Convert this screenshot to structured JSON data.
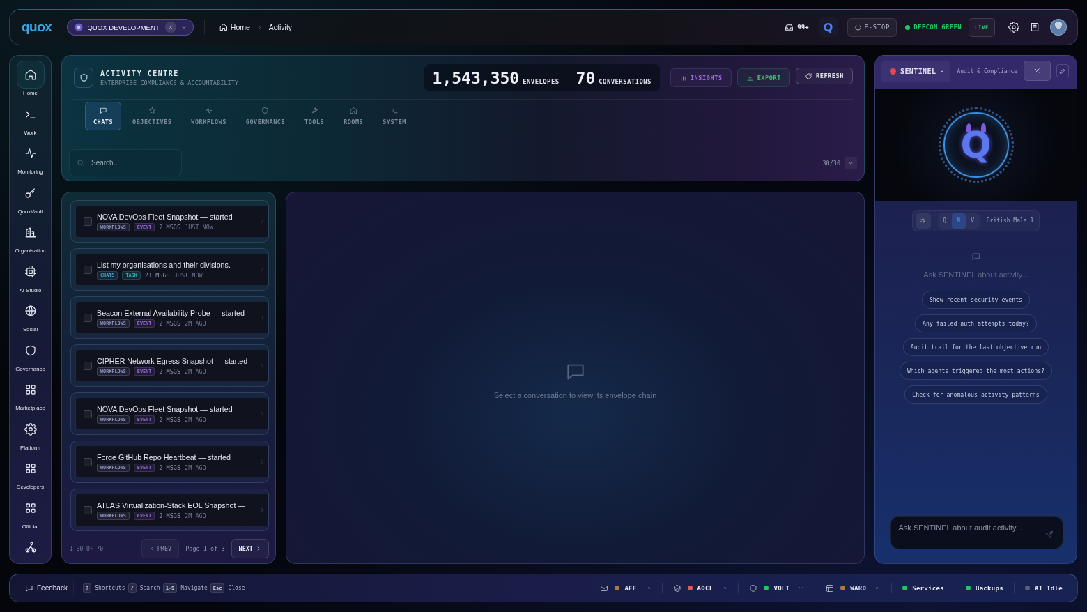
{
  "top_bar": {
    "logo": "quox",
    "workspace": {
      "label": "QUOX DEVELOPMENT"
    },
    "breadcrumb": [
      {
        "label": "Home"
      },
      {
        "label": "Activity"
      }
    ],
    "inbox_count": "99+",
    "assistant": "Q",
    "estop": "E-STOP",
    "defcon": {
      "label": "DEFCON GREEN",
      "color": "#22c55e"
    },
    "live": "LIVE"
  },
  "sidebar": {
    "items": [
      {
        "label": "Home",
        "selected": true
      },
      {
        "label": "Work",
        "selected": false
      },
      {
        "label": "Monitoring",
        "selected": false
      },
      {
        "label": "QuoxVault",
        "selected": false
      },
      {
        "label": "Organisation",
        "selected": false
      },
      {
        "label": "AI Studio",
        "selected": false
      },
      {
        "label": "Social",
        "selected": false
      },
      {
        "label": "Governance",
        "selected": false
      },
      {
        "label": "Marketplace",
        "selected": false
      },
      {
        "label": "Platform",
        "selected": false
      },
      {
        "label": "Developers",
        "selected": false
      },
      {
        "label": "Official",
        "selected": false
      },
      {
        "selected": false
      }
    ]
  },
  "activity": {
    "title": "ACTIVITY CENTRE",
    "subtitle": "ENTERPRISE COMPLIANCE & ACCOUNTABILITY",
    "stats": [
      {
        "value": "1,543,350",
        "label": "ENVELOPES"
      },
      {
        "value": "70",
        "label": "CONVERSATIONS"
      }
    ],
    "actions": [
      {
        "kind": "insights",
        "label": "INSIGHTS"
      },
      {
        "kind": "export",
        "label": "EXPORT"
      },
      {
        "kind": "refresh",
        "label": "REFRESH"
      }
    ],
    "tabs": [
      {
        "label": "CHATS",
        "selected": true
      },
      {
        "label": "OBJECTIVES",
        "selected": false
      },
      {
        "label": "WORKFLOWS",
        "selected": false
      },
      {
        "label": "GOVERNANCE",
        "selected": false
      },
      {
        "label": "TOOLS",
        "selected": false
      },
      {
        "label": "ROOMS",
        "selected": false
      },
      {
        "label": "SYSTEM",
        "selected": false
      }
    ],
    "search": {
      "placeholder": "Search..."
    },
    "count": "30/30"
  },
  "conversations": {
    "items": [
      {
        "title": "NOVA DevOps Fleet Snapshot — started",
        "checked": false,
        "tags": [
          {
            "label": "WORKFLOWS",
            "color": "#9096c8"
          },
          {
            "label": "EVENT",
            "color": "#9a6ae0"
          }
        ],
        "messages": "2 MSGS",
        "time": "JUST NOW"
      },
      {
        "title": "List my organisations and their divisions.",
        "checked": false,
        "tags": [
          {
            "label": "CHATS",
            "color": "#3fa9d6"
          },
          {
            "label": "TASK",
            "color": "#2fb3b8"
          }
        ],
        "messages": "21 MSGS",
        "time": "JUST NOW"
      },
      {
        "title": "Beacon External Availability Probe — started",
        "checked": false,
        "tags": [
          {
            "label": "WORKFLOWS",
            "color": "#9096c8"
          },
          {
            "label": "EVENT",
            "color": "#9a6ae0"
          }
        ],
        "messages": "2 MSGS",
        "time": "2M AGO"
      },
      {
        "title": "CIPHER Network Egress Snapshot — started",
        "checked": false,
        "tags": [
          {
            "label": "WORKFLOWS",
            "color": "#9096c8"
          },
          {
            "label": "EVENT",
            "color": "#9a6ae0"
          }
        ],
        "messages": "2 MSGS",
        "time": "2M AGO"
      },
      {
        "title": "NOVA DevOps Fleet Snapshot — started",
        "checked": false,
        "tags": [
          {
            "label": "WORKFLOWS",
            "color": "#9096c8"
          },
          {
            "label": "EVENT",
            "color": "#9a6ae0"
          }
        ],
        "messages": "2 MSGS",
        "time": "2M AGO"
      },
      {
        "title": "Forge GitHub Repo Heartbeat — started",
        "checked": false,
        "tags": [
          {
            "label": "WORKFLOWS",
            "color": "#9096c8"
          },
          {
            "label": "EVENT",
            "color": "#9a6ae0"
          }
        ],
        "messages": "2 MSGS",
        "time": "2M AGO"
      },
      {
        "title": "ATLAS Virtualization-Stack EOL Snapshot —",
        "checked": false,
        "tags": [
          {
            "label": "WORKFLOWS",
            "color": "#9096c8"
          },
          {
            "label": "EVENT",
            "color": "#9a6ae0"
          }
        ],
        "messages": "2 MSGS",
        "time": "2M AGO"
      }
    ],
    "range": "1-30 OF 70",
    "prev": {
      "label": "PREV",
      "disabled": true
    },
    "page": "Page 1 of 3",
    "next": {
      "label": "NEXT",
      "disabled": false
    }
  },
  "detail": {
    "empty_message": "Select a conversation to view its envelope chain"
  },
  "sentinel": {
    "agent": {
      "name": "SENTINEL",
      "color": "#e5484d"
    },
    "subtitle": "Audit & Compliance",
    "avatar": "Q",
    "voice_modes": [
      {
        "label": "Q",
        "selected": false
      },
      {
        "label": "N",
        "selected": true
      },
      {
        "label": "V",
        "selected": false
      }
    ],
    "voice_name": "British Male 1",
    "prompt": "Ask SENTINEL about activity...",
    "suggestions": [
      "Show recent security events",
      "Any failed auth attempts today?",
      "Audit trail for the last objective run",
      "Which agents triggered the most actions?",
      "Check for anomalous activity patterns"
    ],
    "input": {
      "placeholder": "Ask SENTINEL about audit activity..."
    }
  },
  "status_bar": {
    "feedback": "Feedback",
    "shortcuts": [
      {
        "key": "?",
        "label": "Shortcuts"
      },
      {
        "key": "/",
        "label": "Search"
      },
      {
        "key": "1-9",
        "label": "Navigate"
      },
      {
        "key": "Esc",
        "label": "Close"
      }
    ],
    "systems": [
      {
        "kind": "menu",
        "label": "AEE",
        "color": "#b07a3c",
        "expanded": false
      },
      {
        "kind": "menu",
        "label": "AOCL",
        "color": "#e05a5a",
        "expanded": false
      },
      {
        "kind": "menu",
        "label": "VOLT",
        "color": "#22c55e",
        "expanded": true
      },
      {
        "kind": "menu",
        "label": "WARD",
        "color": "#b07a3c",
        "expanded": false
      },
      {
        "kind": "plain",
        "label": "Services",
        "color": "#22c55e"
      },
      {
        "kind": "plain",
        "label": "Backups",
        "color": "#22c55e"
      },
      {
        "kind": "plain",
        "label": "AI Idle",
        "color": "#5a6275"
      }
    ]
  }
}
